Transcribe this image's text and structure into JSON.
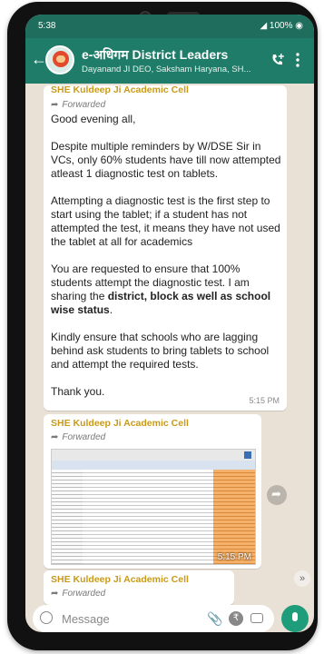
{
  "status_bar": {
    "time": "5:38",
    "battery": "100%"
  },
  "chat_header": {
    "title": "e-अधिगम District Leaders",
    "subtitle": "Dayanand JI DEO, Saksham Haryana, SH..."
  },
  "messages": [
    {
      "sender": "SHE Kuldeep Ji Academic Cell",
      "forwarded": "Forwarded",
      "paragraphs": [
        "Good evening all,",
        "Despite multiple reminders by W/DSE Sir in VCs, only 60% students have till now attempted atleast 1 diagnostic test on tablets.",
        "Attempting a diagnostic test is the first step to start using the tablet; if a student has not attempted the test, it means they have not used the tablet at all for academics",
        "Kindly ensure that schools who are lagging behind ask students to bring tablets to school and attempt the required tests.",
        "Thank you."
      ],
      "p4_prefix": "You are requested to ensure that 100% students attempt the diagnostic test. I am sharing the ",
      "p4_bold": "district, block as well as school wise status",
      "p4_suffix": ".",
      "time": "5:15 PM"
    },
    {
      "sender": "SHE Kuldeep Ji Academic Cell",
      "forwarded": "Forwarded",
      "time": "5:15 PM"
    },
    {
      "sender": "SHE Kuldeep Ji Academic Cell",
      "forwarded": "Forwarded"
    }
  ],
  "input": {
    "placeholder": "Message"
  },
  "colors": {
    "header": "#1f7c68",
    "chat_bg": "#e9e1d6",
    "sender": "#c99a1a",
    "mic": "#1f9c7a"
  }
}
